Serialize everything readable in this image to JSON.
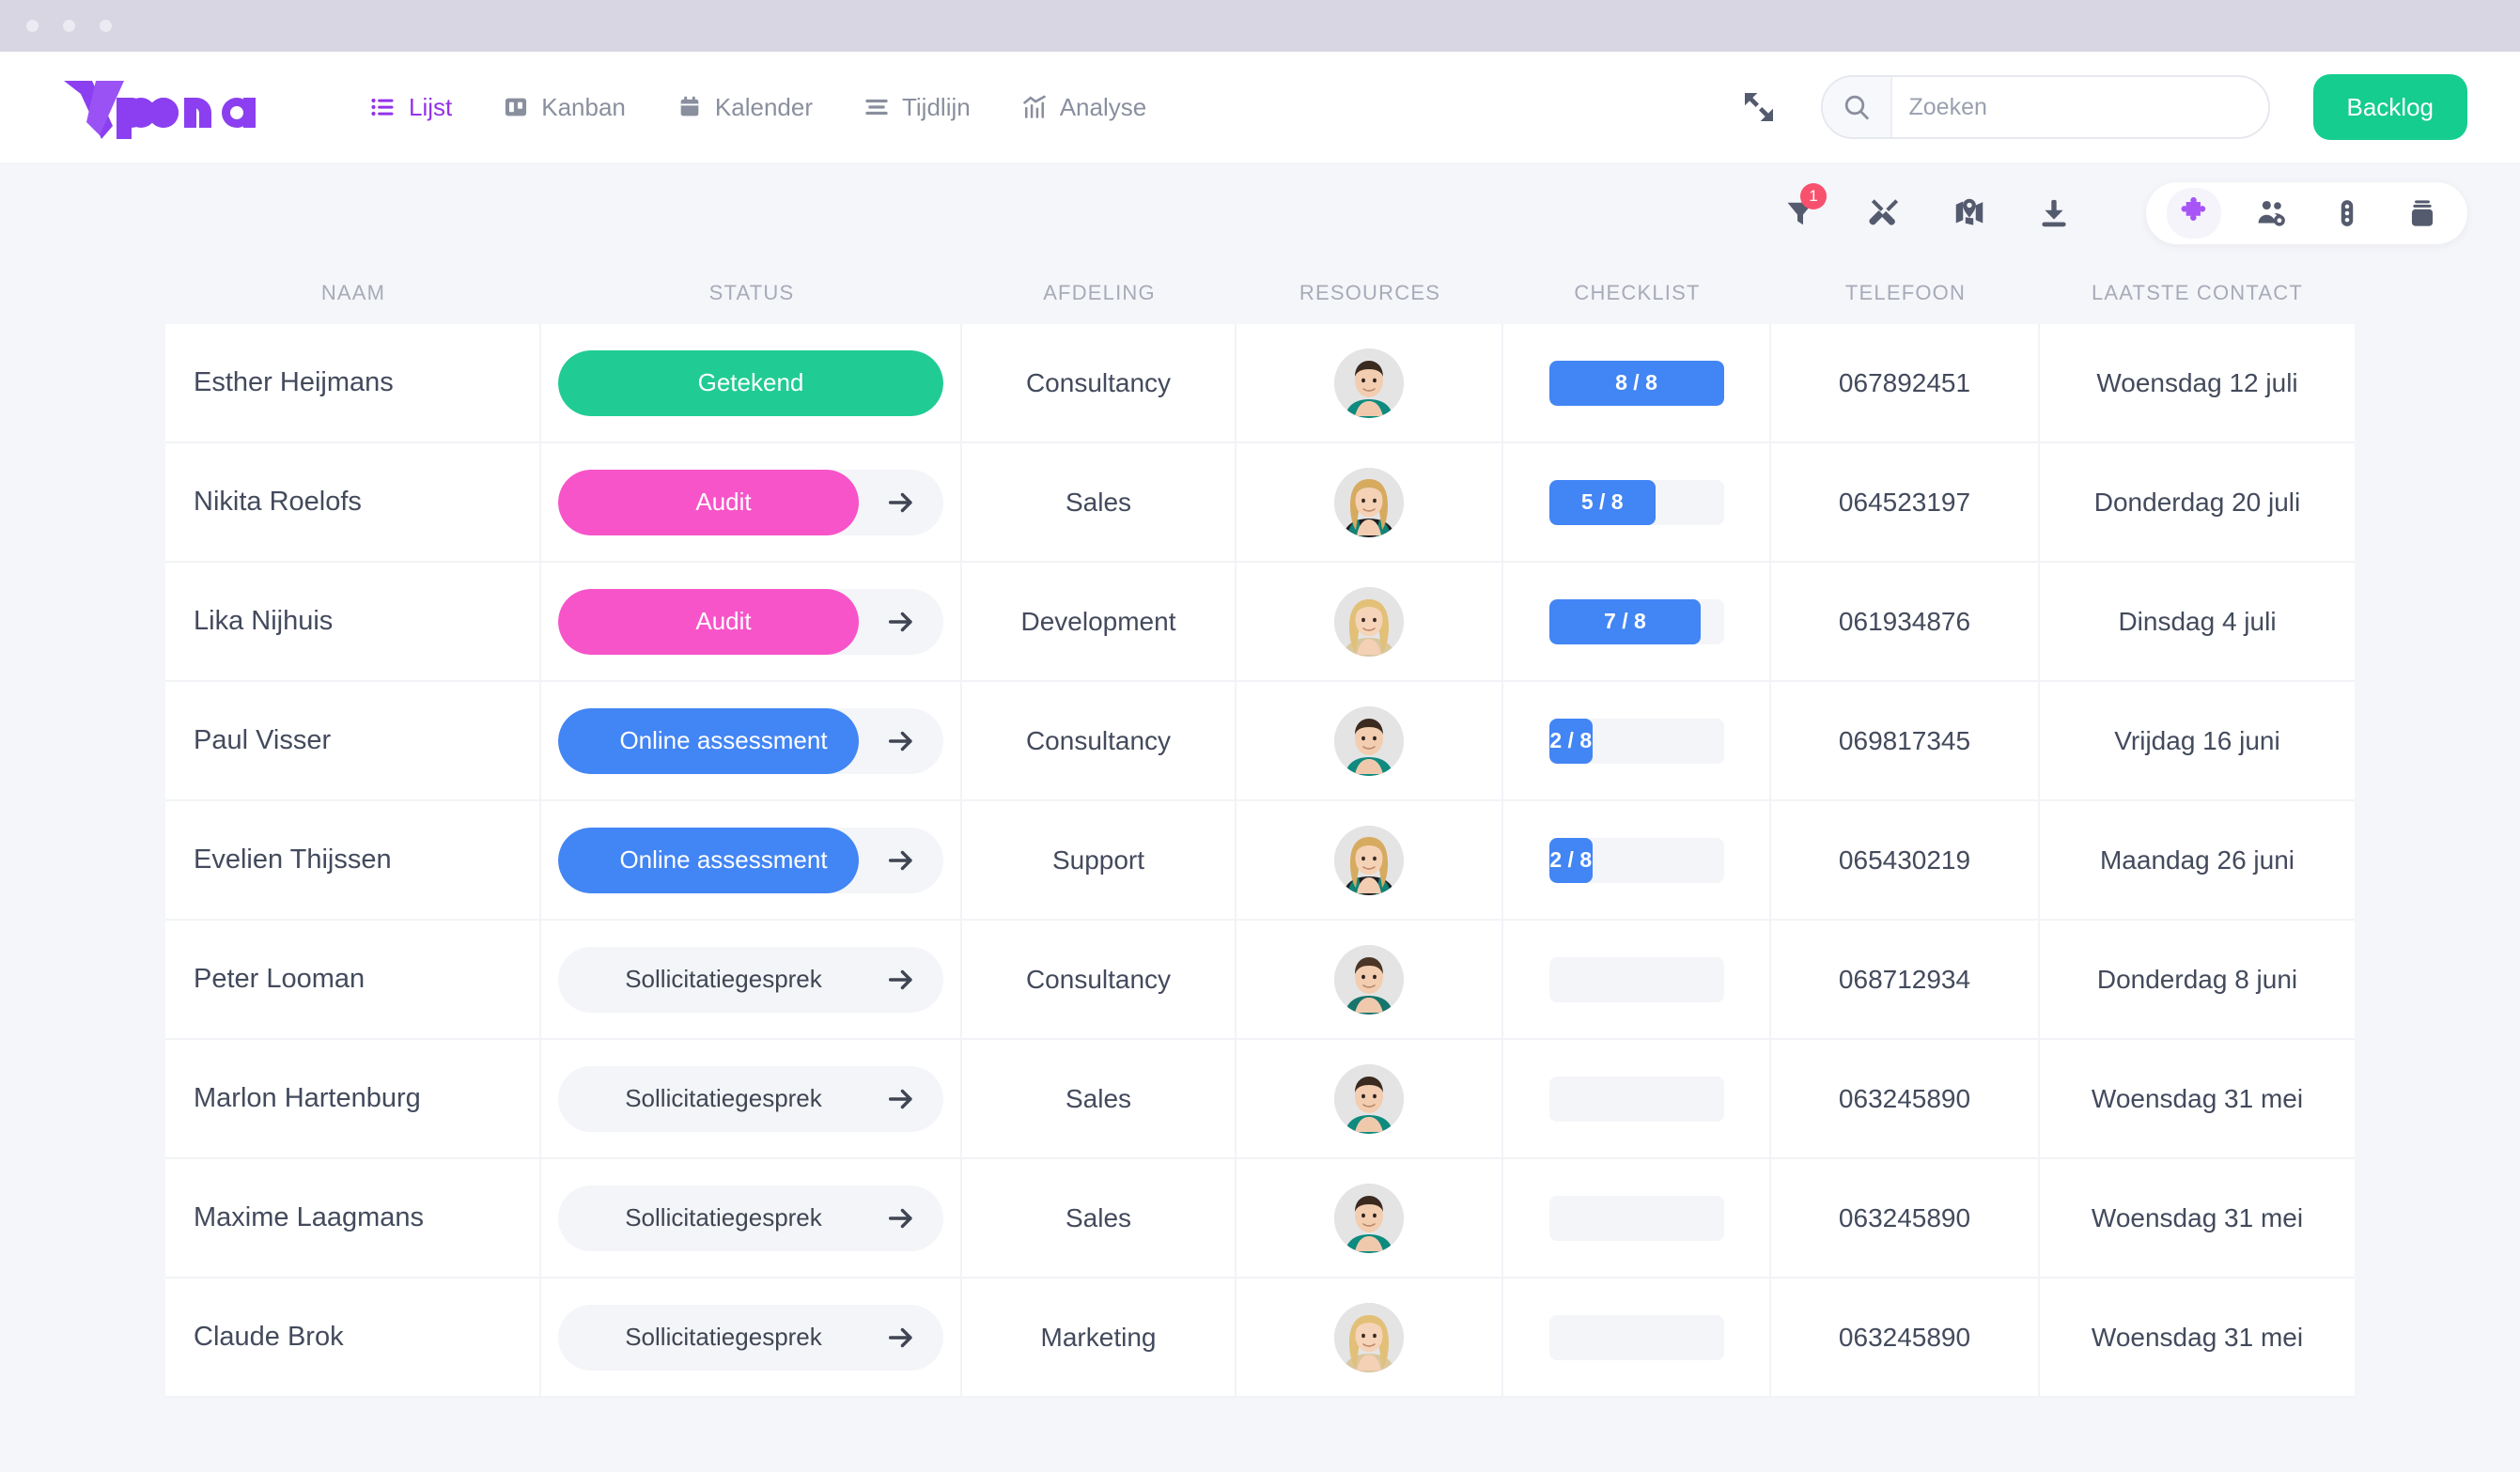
{
  "window": {
    "dots": 3
  },
  "brand": {
    "name": "vplan",
    "color": "#8b3ff0"
  },
  "nav": {
    "items": [
      {
        "label": "Lijst",
        "icon": "list-icon",
        "active": true
      },
      {
        "label": "Kanban",
        "icon": "kanban-icon",
        "active": false
      },
      {
        "label": "Kalender",
        "icon": "calendar-icon",
        "active": false
      },
      {
        "label": "Tijdlijn",
        "icon": "timeline-icon",
        "active": false
      },
      {
        "label": "Analyse",
        "icon": "analytics-icon",
        "active": false
      }
    ]
  },
  "topbar": {
    "expand_icon": "expand-icon",
    "search": {
      "icon": "search-icon",
      "placeholder": "Zoeken",
      "value": ""
    },
    "backlog_label": "Backlog",
    "backlog_color": "#15cd8e"
  },
  "toolbar": {
    "icons": [
      {
        "name": "filter-icon",
        "badge": "1"
      },
      {
        "name": "tools-icon",
        "badge": ""
      },
      {
        "name": "map-icon",
        "badge": ""
      },
      {
        "name": "download-icon",
        "badge": ""
      }
    ],
    "pill_icons": [
      {
        "name": "puzzle-icon",
        "active": true,
        "color": "#a855f7"
      },
      {
        "name": "people-gear-icon",
        "active": false,
        "color": "#555b6e"
      },
      {
        "name": "traffic-light-icon",
        "active": false,
        "color": "#555b6e"
      },
      {
        "name": "archive-icon",
        "active": false,
        "color": "#555b6e"
      }
    ]
  },
  "table": {
    "columns": [
      "NAAM",
      "STATUS",
      "AFDELING",
      "RESOURCES",
      "CHECKLIST",
      "TELEFOON",
      "LAATSTE CONTACT"
    ],
    "rows": [
      {
        "naam": "Esther Heijmans",
        "status": {
          "label": "Getekend",
          "color": "#20cc93",
          "text_color": "#ffffff",
          "fill_pct": 100,
          "arrow": false
        },
        "afdeling": "Consultancy",
        "avatar": "male-1",
        "checklist": {
          "label": "8 / 8",
          "done": 8,
          "total": 8,
          "fill_pct": 100
        },
        "telefoon": "067892451",
        "contact": "Woensdag 12 juli"
      },
      {
        "naam": "Nikita Roelofs",
        "status": {
          "label": "Audit",
          "color": "#f754c9",
          "text_color": "#ffffff",
          "fill_pct": 78,
          "arrow": true
        },
        "afdeling": "Sales",
        "avatar": "female-1",
        "checklist": {
          "label": "5 / 8",
          "done": 5,
          "total": 8,
          "fill_pct": 61
        },
        "telefoon": "064523197",
        "contact": "Donderdag 20 juli"
      },
      {
        "naam": "Lika Nijhuis",
        "status": {
          "label": "Audit",
          "color": "#f754c9",
          "text_color": "#ffffff",
          "fill_pct": 78,
          "arrow": true
        },
        "afdeling": "Development",
        "avatar": "female-2",
        "checklist": {
          "label": "7 / 8",
          "done": 7,
          "total": 8,
          "fill_pct": 87
        },
        "telefoon": "061934876",
        "contact": "Dinsdag 4 juli"
      },
      {
        "naam": "Paul Visser",
        "status": {
          "label": "Online assessment",
          "color": "#4285f4",
          "text_color": "#ffffff",
          "fill_pct": 78,
          "arrow": true
        },
        "afdeling": "Consultancy",
        "avatar": "male-1",
        "checklist": {
          "label": "2 / 8",
          "done": 2,
          "total": 8,
          "fill_pct": 25
        },
        "telefoon": "069817345",
        "contact": "Vrijdag 16 juni"
      },
      {
        "naam": "Evelien Thijssen",
        "status": {
          "label": "Online assessment",
          "color": "#4285f4",
          "text_color": "#ffffff",
          "fill_pct": 78,
          "arrow": true
        },
        "afdeling": "Support",
        "avatar": "female-1",
        "checklist": {
          "label": "2 / 8",
          "done": 2,
          "total": 8,
          "fill_pct": 25
        },
        "telefoon": "065430219",
        "contact": "Maandag 26 juni"
      },
      {
        "naam": "Peter Looman",
        "status": {
          "label": "Sollicitatiegesprek",
          "color": "transparent",
          "text_color": "#3f4553",
          "fill_pct": 0,
          "arrow": true
        },
        "afdeling": "Consultancy",
        "avatar": "male-2",
        "checklist": {
          "label": "",
          "done": 0,
          "total": 8,
          "fill_pct": 0
        },
        "telefoon": "068712934",
        "contact": "Donderdag 8 juni"
      },
      {
        "naam": "Marlon Hartenburg",
        "status": {
          "label": "Sollicitatiegesprek",
          "color": "transparent",
          "text_color": "#3f4553",
          "fill_pct": 0,
          "arrow": true
        },
        "afdeling": "Sales",
        "avatar": "male-1",
        "checklist": {
          "label": "",
          "done": 0,
          "total": 8,
          "fill_pct": 0
        },
        "telefoon": "063245890",
        "contact": "Woensdag 31 mei"
      },
      {
        "naam": "Maxime Laagmans",
        "status": {
          "label": "Sollicitatiegesprek",
          "color": "transparent",
          "text_color": "#3f4553",
          "fill_pct": 0,
          "arrow": true
        },
        "afdeling": "Sales",
        "avatar": "male-1",
        "checklist": {
          "label": "",
          "done": 0,
          "total": 8,
          "fill_pct": 0
        },
        "telefoon": "063245890",
        "contact": "Woensdag 31 mei"
      },
      {
        "naam": "Claude Brok",
        "status": {
          "label": "Sollicitatiegesprek",
          "color": "transparent",
          "text_color": "#3f4553",
          "fill_pct": 0,
          "arrow": true
        },
        "afdeling": "Marketing",
        "avatar": "female-2",
        "checklist": {
          "label": "",
          "done": 0,
          "total": 8,
          "fill_pct": 0
        },
        "telefoon": "063245890",
        "contact": "Woensdag 31 mei"
      }
    ]
  }
}
